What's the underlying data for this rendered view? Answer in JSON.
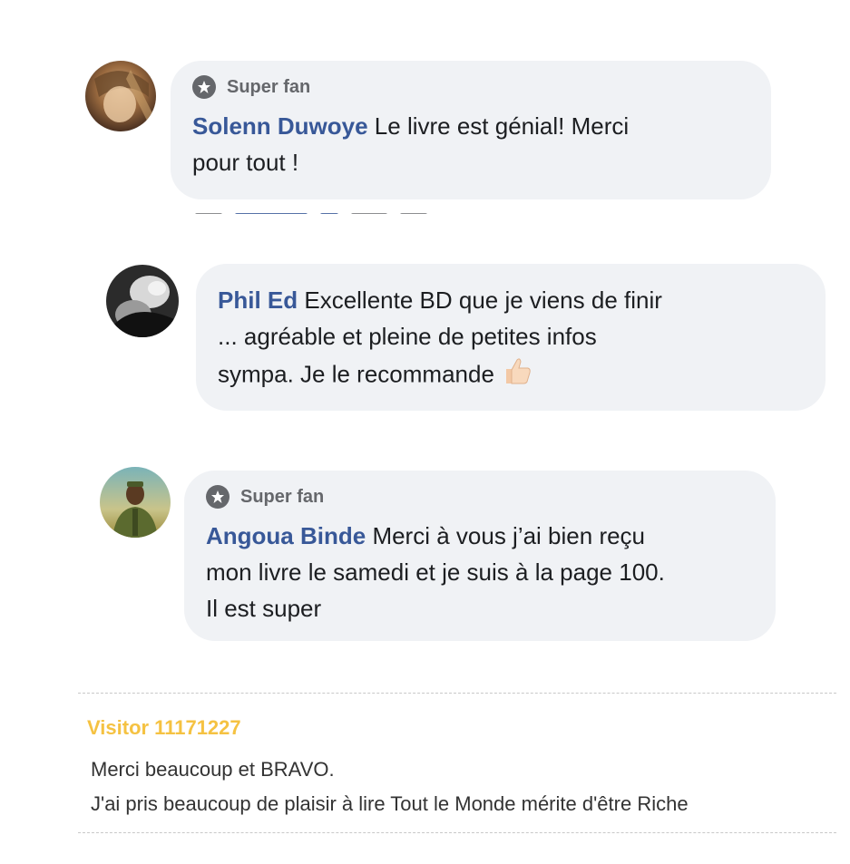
{
  "comments": [
    {
      "badge": "Super fan",
      "author": "Solenn Duwoye",
      "text_line1": " Le livre est génial! Merci",
      "text_line2": "pour tout !"
    },
    {
      "author": "Phil Ed",
      "text_line1": " Excellente BD que je viens de finir",
      "text_line2": "... agréable et pleine de petites infos",
      "text_line3": "sympa. Je le recommande ",
      "emoji": "thumbs-up-icon"
    },
    {
      "badge": "Super fan",
      "author": "Angoua Binde",
      "text_line1": " Merci à vous j’ai bien reçu",
      "text_line2": "mon livre le samedi et je suis à la page 100.",
      "text_line3": "Il est super"
    }
  ],
  "visitor": {
    "name": "Visitor 11171227",
    "line1": "Merci beaucoup et BRAVO.",
    "line2": "J'ai pris beaucoup de plaisir à lire Tout le Monde mérite d'être Riche"
  },
  "colors": {
    "author_link": "#385898",
    "bubble_bg": "#f0f2f5",
    "visitor_name": "#f5c242",
    "badge_gray": "#65676b"
  }
}
